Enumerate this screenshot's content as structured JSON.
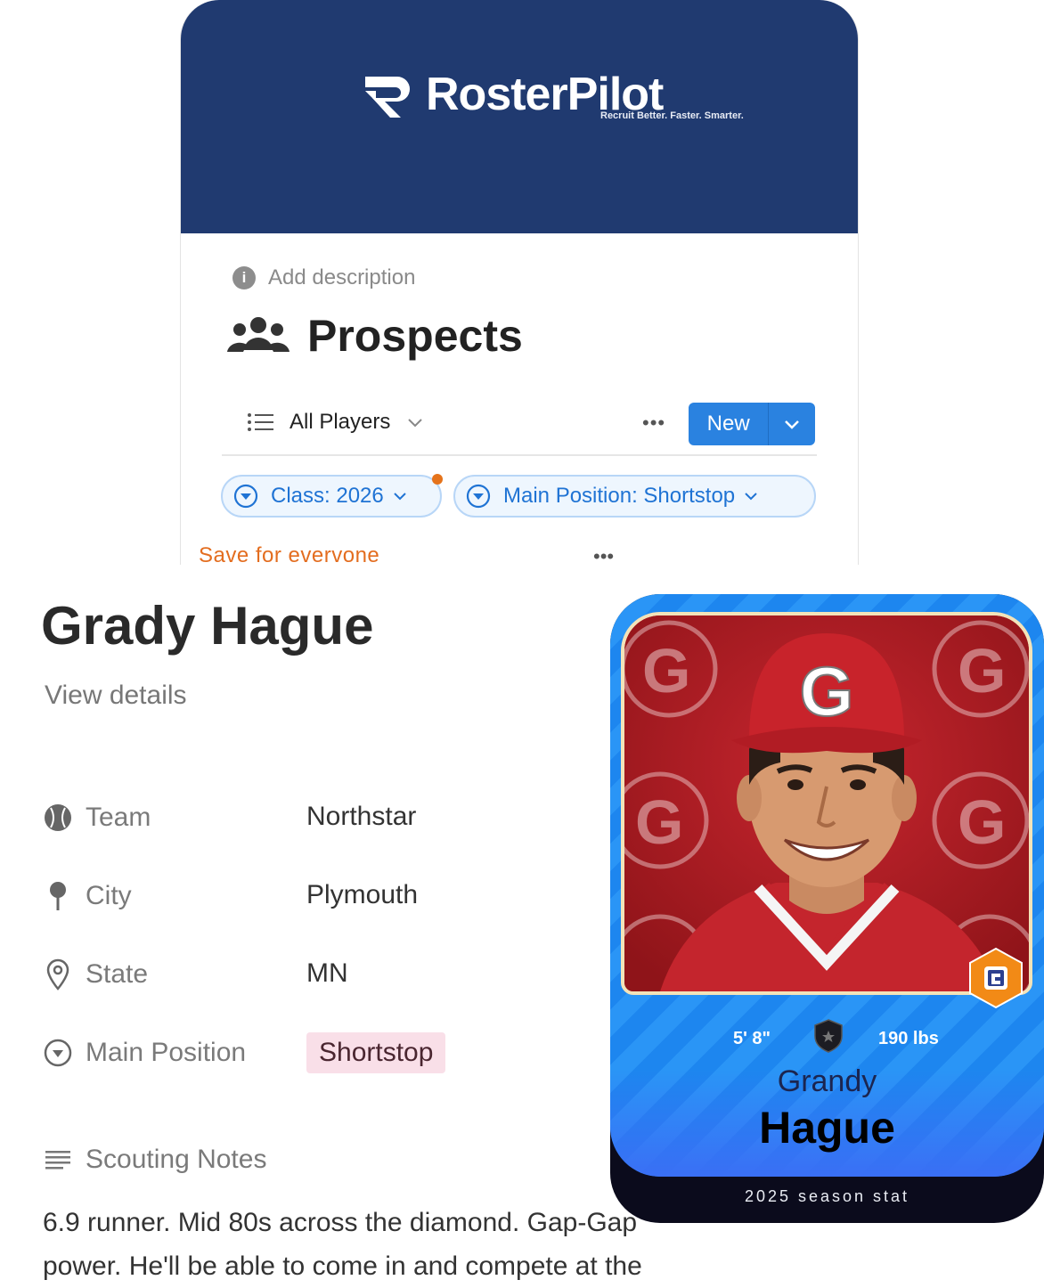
{
  "brand": {
    "name": "RosterPilot",
    "tagline": "Recruit Better. Faster. Smarter."
  },
  "database": {
    "add_description": "Add description",
    "title": "Prospects",
    "icon": "people-icon",
    "view_name": "All Players",
    "new_label": "New",
    "filters": [
      {
        "label": "Class: 2026"
      },
      {
        "label": "Main Position: Shortstop"
      }
    ],
    "save_label": "Save for evervone"
  },
  "player": {
    "name": "Grady Hague",
    "view_details": "View details",
    "properties": [
      {
        "label": "Team",
        "value": "Northstar",
        "icon": "baseball-icon"
      },
      {
        "label": "City",
        "value": "Plymouth",
        "icon": "pin-icon"
      },
      {
        "label": "State",
        "value": "MN",
        "icon": "location-icon"
      },
      {
        "label": "Main Position",
        "value": "Shortstop",
        "icon": "select-icon"
      }
    ],
    "notes_label": "Scouting Notes",
    "notes": "6.9 runner. Mid 80s across the diamond. Gap-Gap power. He'll be able to come in and compete at the"
  },
  "card": {
    "first_name": "Grandy",
    "last_name": "Hague",
    "height": "5' 8\"",
    "weight": "190 lbs",
    "footer": "2025 season stat",
    "cap_letter": "G"
  },
  "colors": {
    "header": "#203a70",
    "accent_blue": "#2a82e0",
    "save_orange": "#e36d1f",
    "tag_pink": "#f9dfe8",
    "card_blue": "#1d86ef"
  }
}
